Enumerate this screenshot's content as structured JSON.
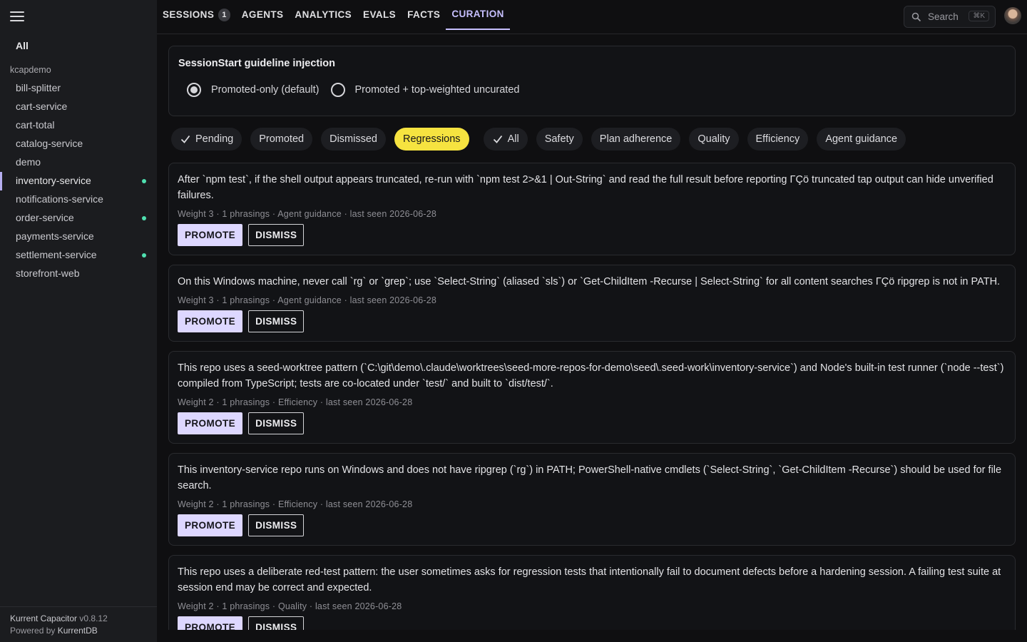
{
  "sidebar": {
    "all_label": "All",
    "group_label": "kcapdemo",
    "items": [
      {
        "label": "bill-splitter",
        "active": false,
        "dot": false
      },
      {
        "label": "cart-service",
        "active": false,
        "dot": false
      },
      {
        "label": "cart-total",
        "active": false,
        "dot": false
      },
      {
        "label": "catalog-service",
        "active": false,
        "dot": false
      },
      {
        "label": "demo",
        "active": false,
        "dot": false
      },
      {
        "label": "inventory-service",
        "active": true,
        "dot": true
      },
      {
        "label": "notifications-service",
        "active": false,
        "dot": false
      },
      {
        "label": "order-service",
        "active": false,
        "dot": true
      },
      {
        "label": "payments-service",
        "active": false,
        "dot": false
      },
      {
        "label": "settlement-service",
        "active": false,
        "dot": true
      },
      {
        "label": "storefront-web",
        "active": false,
        "dot": false
      }
    ],
    "footer": {
      "product": "Kurrent Capacitor",
      "version": "v0.8.12",
      "powered_prefix": "Powered by",
      "powered_name": "KurrentDB"
    }
  },
  "topbar": {
    "tabs": [
      {
        "label": "SESSIONS",
        "badge": "1",
        "active": false
      },
      {
        "label": "AGENTS",
        "active": false
      },
      {
        "label": "ANALYTICS",
        "active": false
      },
      {
        "label": "EVALS",
        "active": false
      },
      {
        "label": "FACTS",
        "active": false
      },
      {
        "label": "CURATION",
        "active": true
      }
    ],
    "search_placeholder": "Search",
    "search_shortcut": "⌘K"
  },
  "injection_panel": {
    "title": "SessionStart guideline injection",
    "options": [
      {
        "label": "Promoted-only (default)",
        "checked": true
      },
      {
        "label": "Promoted + top-weighted uncurated",
        "checked": false
      }
    ]
  },
  "status_filters": [
    {
      "label": "Pending",
      "checked": true,
      "selected": false
    },
    {
      "label": "Promoted",
      "checked": false,
      "selected": false
    },
    {
      "label": "Dismissed",
      "checked": false,
      "selected": false
    },
    {
      "label": "Regressions",
      "checked": false,
      "selected": true
    }
  ],
  "category_filters": [
    {
      "label": "All",
      "checked": true
    },
    {
      "label": "Safety",
      "checked": false
    },
    {
      "label": "Plan adherence",
      "checked": false
    },
    {
      "label": "Quality",
      "checked": false
    },
    {
      "label": "Efficiency",
      "checked": false
    },
    {
      "label": "Agent guidance",
      "checked": false
    }
  ],
  "cards": [
    {
      "text": "After `npm test`, if the shell output appears truncated, re-run with `npm test 2>&1 | Out-String` and read the full result before reporting ΓÇö truncated tap output can hide unverified failures.",
      "meta": "Weight 3 · 1 phrasings · Agent guidance · last seen 2026-06-28",
      "promote_label": "PROMOTE",
      "dismiss_label": "DISMISS"
    },
    {
      "text": "On this Windows machine, never call `rg` or `grep`; use `Select-String` (aliased `sls`) or `Get-ChildItem -Recurse | Select-String` for all content searches ΓÇö ripgrep is not in PATH.",
      "meta": "Weight 3 · 1 phrasings · Agent guidance · last seen 2026-06-28",
      "promote_label": "PROMOTE",
      "dismiss_label": "DISMISS"
    },
    {
      "text": "This repo uses a seed-worktree pattern (`C:\\git\\demo\\.claude\\worktrees\\seed-more-repos-for-demo\\seed\\.seed-work\\inventory-service`) and Node's built-in test runner (`node --test`) compiled from TypeScript; tests are co-located under `test/` and built to `dist/test/`.",
      "meta": "Weight 2 · 1 phrasings · Efficiency · last seen 2026-06-28",
      "promote_label": "PROMOTE",
      "dismiss_label": "DISMISS"
    },
    {
      "text": "This inventory-service repo runs on Windows and does not have ripgrep (`rg`) in PATH; PowerShell-native cmdlets (`Select-String`, `Get-ChildItem -Recurse`) should be used for file search.",
      "meta": "Weight 2 · 1 phrasings · Efficiency · last seen 2026-06-28",
      "promote_label": "PROMOTE",
      "dismiss_label": "DISMISS"
    },
    {
      "text": "This repo uses a deliberate red-test pattern: the user sometimes asks for regression tests that intentionally fail to document defects before a hardening session. A failing test suite at session end may be correct and expected.",
      "meta": "Weight 2 · 1 phrasings · Quality · last seen 2026-06-28",
      "promote_label": "PROMOTE",
      "dismiss_label": "DISMISS"
    }
  ],
  "colors": {
    "accent": "#c7c0ff",
    "selected_chip": "#f6e340",
    "promote_bg": "#ddd7ff",
    "status_dot": "#4fe0b0"
  },
  "icons": {
    "menu": "hamburger-menu-icon",
    "search": "search-icon",
    "check": "check-icon",
    "avatar": "user-avatar"
  }
}
